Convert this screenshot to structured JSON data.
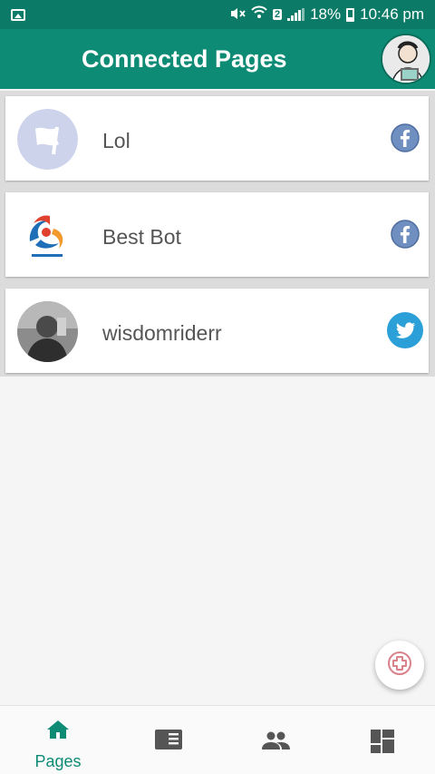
{
  "status_bar": {
    "battery_percent": "18%",
    "time": "10:46 pm",
    "sim_badge": "2",
    "icons": [
      "image-icon",
      "mute-icon",
      "wifi-icon",
      "signal-icon",
      "battery-icon"
    ]
  },
  "app_bar": {
    "title": "Connected Pages",
    "avatar_icon": "profile-avatar"
  },
  "pages": [
    {
      "name": "Lol",
      "network": "facebook",
      "thumb": "flag-avatar-icon"
    },
    {
      "name": "Best Bot",
      "network": "facebook",
      "thumb": "best-bot-logo"
    },
    {
      "name": "wisdomriderr",
      "network": "twitter",
      "thumb": "user-photo"
    }
  ],
  "fab": {
    "icon": "add-icon"
  },
  "bottom_nav": {
    "items": [
      {
        "label": "Pages",
        "icon": "home-icon",
        "active": true
      },
      {
        "label": "",
        "icon": "newspaper-icon",
        "active": false
      },
      {
        "label": "",
        "icon": "people-icon",
        "active": false
      },
      {
        "label": "",
        "icon": "dashboard-icon",
        "active": false
      }
    ]
  },
  "colors": {
    "primary": "#0e8b74",
    "status_bar": "#0b7a66",
    "facebook": "#6f8fc0",
    "twitter": "#2a9fd8",
    "fab_accent": "#d9828a"
  }
}
